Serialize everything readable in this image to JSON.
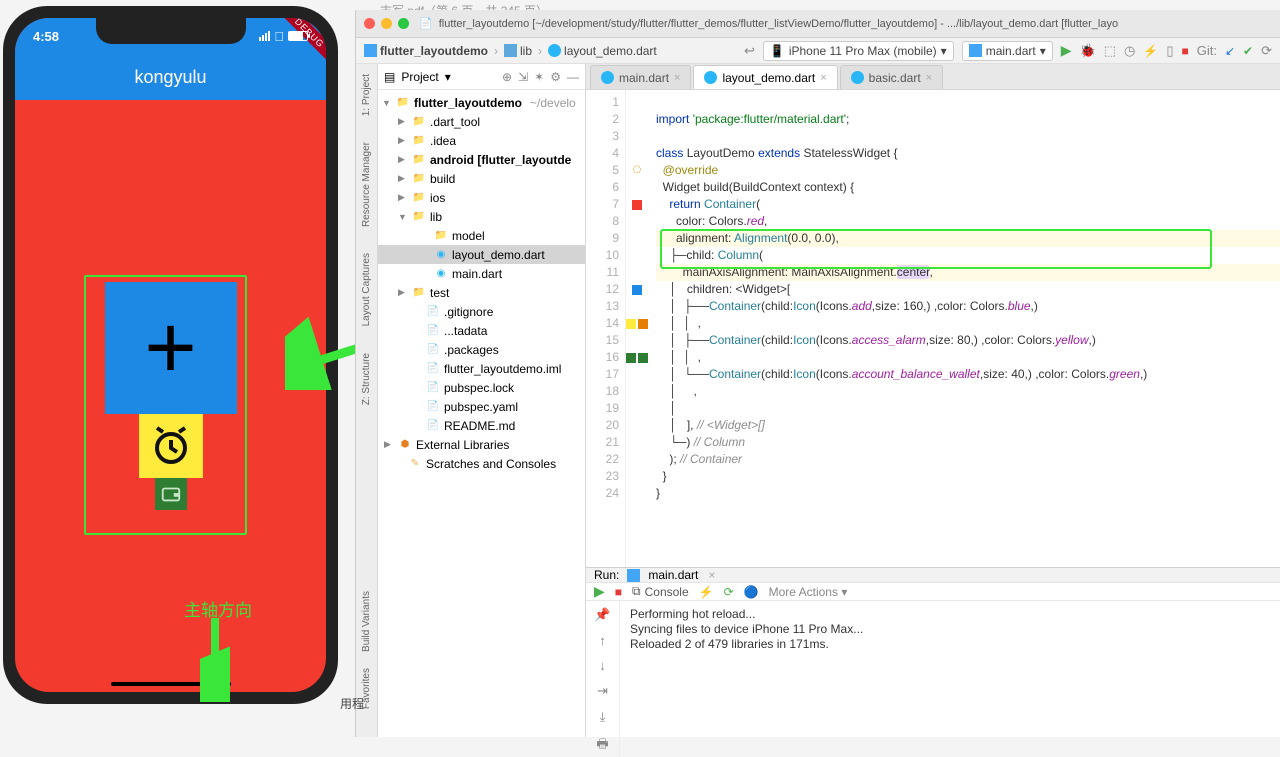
{
  "bg_pdf": "志军.pdf（第 6 页，共 345 页）",
  "phone": {
    "time": "4:58",
    "app_title": "kongyulu",
    "debug": "DEBUG",
    "axis_label": "主轴方向"
  },
  "mac": {
    "nav_back": "‹",
    "nav_fwd": "›",
    "nav_split": "⌥"
  },
  "titlebar": "flutter_layoutdemo [~/development/study/flutter/flutter_demos/flutter_listViewDemo/flutter_layoutdemo] - .../lib/layout_demo.dart [flutter_layo",
  "breadcrumb": {
    "root": "flutter_layoutdemo",
    "lib": "lib",
    "file": "layout_demo.dart"
  },
  "toolbar": {
    "device": "iPhone 11 Pro Max (mobile)",
    "config": "main.dart",
    "git_label": "Git:"
  },
  "project": {
    "title": "Project",
    "root": "flutter_layoutdemo",
    "root_hint": "~/develo",
    "items": [
      ".dart_tool",
      ".idea",
      "android [flutter_layoutde",
      "build",
      "ios",
      "lib",
      "model",
      "layout_demo.dart",
      "main.dart",
      "test",
      ".gitignore",
      "...tadata",
      ".packages",
      "flutter_layoutdemo.iml",
      "pubspec.lock",
      "pubspec.yaml",
      "README.md",
      "External Libraries",
      "Scratches and Consoles"
    ]
  },
  "tabs": {
    "t1": "main.dart",
    "t2": "layout_demo.dart",
    "t3": "basic.dart"
  },
  "code": {
    "l1": "import 'package:flutter/material.dart';",
    "l3a": "class ",
    "l3b": "LayoutDemo ",
    "l3c": "extends ",
    "l3d": "StatelessWidget {",
    "l4": "  @override",
    "l5a": "  Widget build(BuildContext context) {",
    "l6a": "    return ",
    "l6b": "Container(",
    "l7": "      color: Colors.red,",
    "l8a": "      alignment: ",
    "l8b": "Alignment(0.0, 0.0),",
    "l9a": "      child: ",
    "l9b": "Column(",
    "l10a": "        mainAxisAlignment: MainAxisAlignment.",
    "l10b": "center",
    "l10c": ",",
    "l11": "        children: <Widget>[",
    "l12a": "          Container(child:",
    "l12b": "Icon",
    "l12c": "(Icons.",
    "l12d": "add",
    "l12e": ",size: 160,) ,color: Colors.",
    "l12f": "blue",
    "l12g": ",)",
    "l13": "          ,",
    "l14a": "          Container(child:",
    "l14b": "Icon",
    "l14c": "(Icons.",
    "l14d": "access_alarm",
    "l14e": ",size: 80,) ,color: Colors.",
    "l14f": "yellow",
    "l14g": ",)",
    "l15": "          ,",
    "l16a": "          Container(child:",
    "l16b": "Icon",
    "l16c": "(Icons.",
    "l16d": "account_balance_wallet",
    "l16e": ",size: 40,) ,color: Colors.",
    "l16f": "green",
    "l16g": ",)",
    "l17": "          ,",
    "l19a": "        ], ",
    "l19b": "// <Widget>[]",
    "l20a": "      ) ",
    "l20b": "// Column",
    "l21a": "    ); ",
    "l21b": "// Container",
    "l22": "  }",
    "l23": "}"
  },
  "lines": [
    "1",
    "2",
    "3",
    "4",
    "5",
    "6",
    "7",
    "8",
    "9",
    "10",
    "11",
    "12",
    "13",
    "14",
    "15",
    "16",
    "17",
    "18",
    "19",
    "20",
    "21",
    "22",
    "23",
    "24"
  ],
  "run": {
    "label": "Run:",
    "config": "main.dart",
    "console_tab": "Console",
    "more": "More Actions",
    "out1": "Performing hot reload...",
    "out2": "Syncing files to device iPhone 11 Pro Max...",
    "out3": "Reloaded 2 of 479 libraries in 171ms."
  },
  "left_tabs": {
    "project": "1: Project",
    "resmgr": "Resource Manager",
    "layout": "Layout Captures",
    "structure": "Z: Structure",
    "variants": "Build Variants",
    "favorites": "Favorites"
  },
  "ui_text": {
    "chinese_footer": "用程"
  }
}
